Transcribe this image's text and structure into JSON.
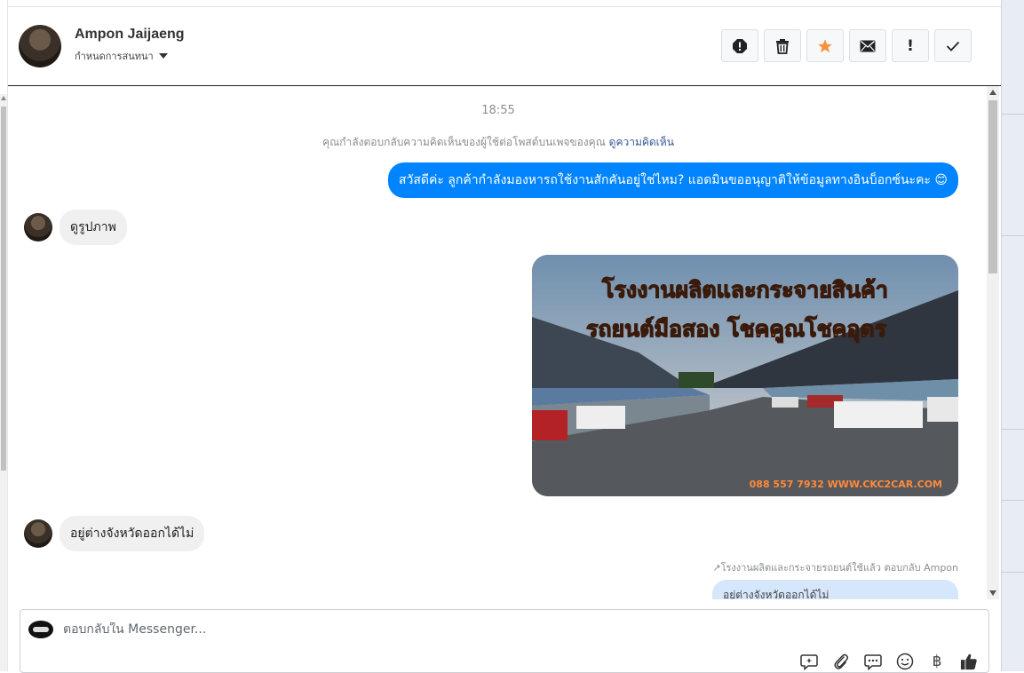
{
  "header": {
    "name": "Ampon Jaijaeng",
    "assign_label": "กำหนดการสนทนา",
    "actions": [
      {
        "icon": "spam-icon"
      },
      {
        "icon": "trash-icon"
      },
      {
        "icon": "star-icon"
      },
      {
        "icon": "mail-icon"
      },
      {
        "icon": "exclamation-icon",
        "glyph": "!"
      },
      {
        "icon": "check-icon"
      }
    ],
    "star_color": "#f7923a"
  },
  "thread": {
    "time": "18:55",
    "notice_text": "คุณกำลังตอบกลับความคิดเห็นของผู้ใช้ต่อโพสต์บนเพจของคุณ",
    "notice_link": "ดูความคิดเห็น",
    "outgoing_1": "สวัสดีค่ะ ลูกค้ากำลังมองหารถใช้งานสักคันอยู่ใช่ไหม? แอดมินขออนุญาติให้ข้อมูลทางอินบ็อกซ์นะคะ 😊",
    "incoming_1": "ดูรูปภาพ",
    "photo": {
      "title_line1": "โรงงานผลิตและกระจายสินค้า",
      "title_line2": "รถยนต์มือสอง โชคคูณโชคอุดร",
      "footer": "088 557 7932 WWW.CKC2CAR.COM"
    },
    "incoming_2": "อยู่ต่างจังหวัดออกได้ไม่",
    "replied_note": "โรงงานผลิตและกระจายรถยนต์ใช้แล้ว ตอบกลับ Ampon",
    "quoted_text": "อยู่ต่างจังหวัดออกได้ไม่",
    "outgoing_color": "#0084ff"
  },
  "composer": {
    "placeholder": "ตอบกลับใน Messenger...",
    "tools": [
      {
        "icon": "comment-bubble-icon"
      },
      {
        "icon": "paperclip-icon"
      },
      {
        "icon": "saved-reply-icon"
      },
      {
        "icon": "emoji-icon"
      },
      {
        "icon": "baht-icon",
        "glyph": "฿"
      },
      {
        "icon": "thumbs-up-icon"
      }
    ]
  }
}
